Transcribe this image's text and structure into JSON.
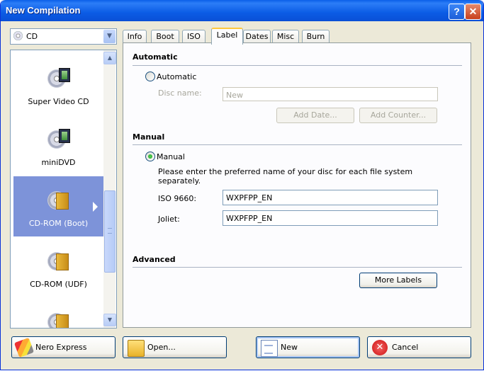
{
  "window": {
    "title": "New Compilation",
    "help_label": "?",
    "close_label": "✕"
  },
  "media_combo": {
    "value": "CD"
  },
  "media_list": {
    "items": [
      {
        "label": "Super Video CD",
        "icon": "video-disc-icon"
      },
      {
        "label": "miniDVD",
        "icon": "video-disc-icon"
      },
      {
        "label": "CD-ROM (Boot)",
        "icon": "data-disc-icon",
        "selected": true
      },
      {
        "label": "CD-ROM (UDF)",
        "icon": "data-disc-icon"
      },
      {
        "label": "",
        "icon": "data-disc-icon"
      }
    ]
  },
  "tabs": [
    {
      "label": "Info"
    },
    {
      "label": "Boot"
    },
    {
      "label": "ISO"
    },
    {
      "label": "Label",
      "active": true
    },
    {
      "label": "Dates"
    },
    {
      "label": "Misc"
    },
    {
      "label": "Burn"
    }
  ],
  "automatic": {
    "heading": "Automatic",
    "radio_label": "Automatic",
    "disc_name_label": "Disc name:",
    "disc_name_value": "New",
    "add_date_label": "Add Date...",
    "add_counter_label": "Add Counter..."
  },
  "manual": {
    "heading": "Manual",
    "radio_label": "Manual",
    "instruction_line1": "Please enter the preferred name of your disc for each file system",
    "instruction_line2": "separately.",
    "iso_label": "ISO 9660:",
    "iso_value": "WXPFPP_EN",
    "joliet_label": "Joliet:",
    "joliet_value": "WXPFPP_EN"
  },
  "advanced": {
    "heading": "Advanced",
    "more_labels_label": "More Labels"
  },
  "footer": {
    "nero_express_label": "Nero Express",
    "open_label": "Open...",
    "new_label": "New",
    "cancel_label": "Cancel"
  },
  "colors": {
    "selection": "#7d93d9",
    "titlebar": "#0a5fe8",
    "tab_highlight": "#ffc83c"
  }
}
